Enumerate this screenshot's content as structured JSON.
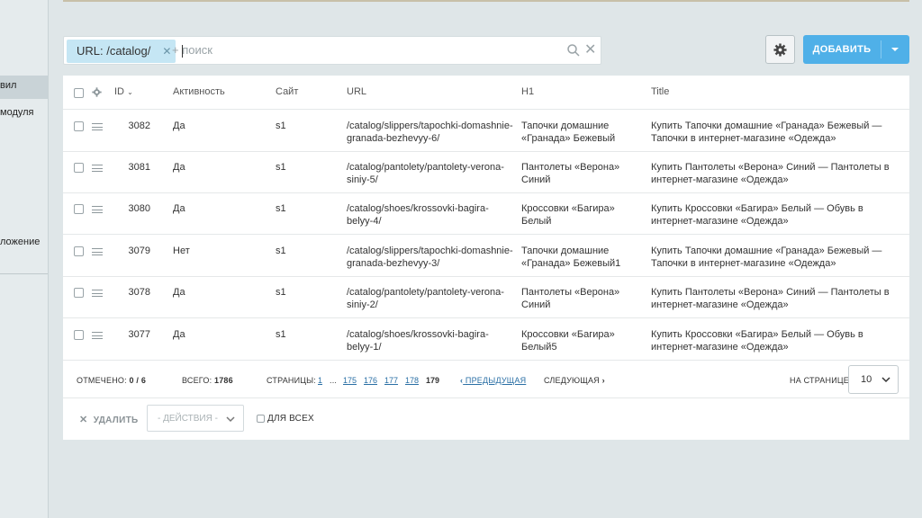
{
  "sidebar": {
    "items": [
      {
        "label": "вил"
      },
      {
        "label": "модуля"
      },
      {
        "label": "ложение"
      }
    ]
  },
  "filter": {
    "chip_label": "URL: /catalog/",
    "search_placeholder": "+ поиск"
  },
  "toolbar": {
    "add_label": "ДОБАВИТЬ"
  },
  "table": {
    "columns": {
      "id": "ID",
      "activity": "Активность",
      "site": "Сайт",
      "url": "URL",
      "h1": "H1",
      "title": "Title"
    },
    "rows": [
      {
        "id": "3082",
        "activity": "Да",
        "site": "s1",
        "url": "/catalog/slippers/tapochki-domashnie-granada-bezhevyy-6/",
        "h1": "Тапочки домашние «Гранада» Бежевый",
        "title": "Купить Тапочки домашние «Гранада» Бежевый — Тапочки в интернет-магазине «Одежда»"
      },
      {
        "id": "3081",
        "activity": "Да",
        "site": "s1",
        "url": "/catalog/pantolety/pantolety-verona-siniy-5/",
        "h1": "Пантолеты «Верона» Синий",
        "title": "Купить Пантолеты «Верона» Синий — Пантолеты в интернет-магазине «Одежда»"
      },
      {
        "id": "3080",
        "activity": "Да",
        "site": "s1",
        "url": "/catalog/shoes/krossovki-bagira-belyy-4/",
        "h1": "Кроссовки «Багира» Белый",
        "title": "Купить Кроссовки «Багира» Белый — Обувь в интернет-магазине «Одежда»"
      },
      {
        "id": "3079",
        "activity": "Нет",
        "site": "s1",
        "url": "/catalog/slippers/tapochki-domashnie-granada-bezhevyy-3/",
        "h1": "Тапочки домашние «Гранада» Бежевый1",
        "title": "Купить Тапочки домашние «Гранада» Бежевый — Тапочки в интернет-магазине «Одежда»"
      },
      {
        "id": "3078",
        "activity": "Да",
        "site": "s1",
        "url": "/catalog/pantolety/pantolety-verona-siniy-2/",
        "h1": "Пантолеты «Верона» Синий",
        "title": "Купить Пантолеты «Верона» Синий — Пантолеты в интернет-магазине «Одежда»"
      },
      {
        "id": "3077",
        "activity": "Да",
        "site": "s1",
        "url": "/catalog/shoes/krossovki-bagira-belyy-1/",
        "h1": "Кроссовки «Багира» Белый5",
        "title": "Купить Кроссовки «Багира» Белый — Обувь в интернет-магазине «Одежда»"
      }
    ]
  },
  "footer": {
    "selected_label": "ОТМЕЧЕНО:",
    "selected_value": "0 / 6",
    "total_label": "ВСЕГО:",
    "total_value": "1786",
    "pages_label": "СТРАНИЦЫ:",
    "pages": [
      "1",
      "...",
      "175",
      "176",
      "177",
      "178",
      "179"
    ],
    "prev_label": "ПРЕДЫДУЩАЯ",
    "next_label": "СЛЕДУЮЩАЯ",
    "per_page_label": "НА СТРАНИЦЕ:",
    "per_page_value": "10"
  },
  "actions": {
    "delete_label": "УДАЛИТЬ",
    "actions_placeholder": "- ДЕЙСТВИЯ -",
    "for_all_label": "ДЛЯ ВСЕХ"
  },
  "colors": {
    "accent": "#4fb0e8",
    "chip_bg": "#c5e6f4",
    "link": "#2a6fa5"
  }
}
